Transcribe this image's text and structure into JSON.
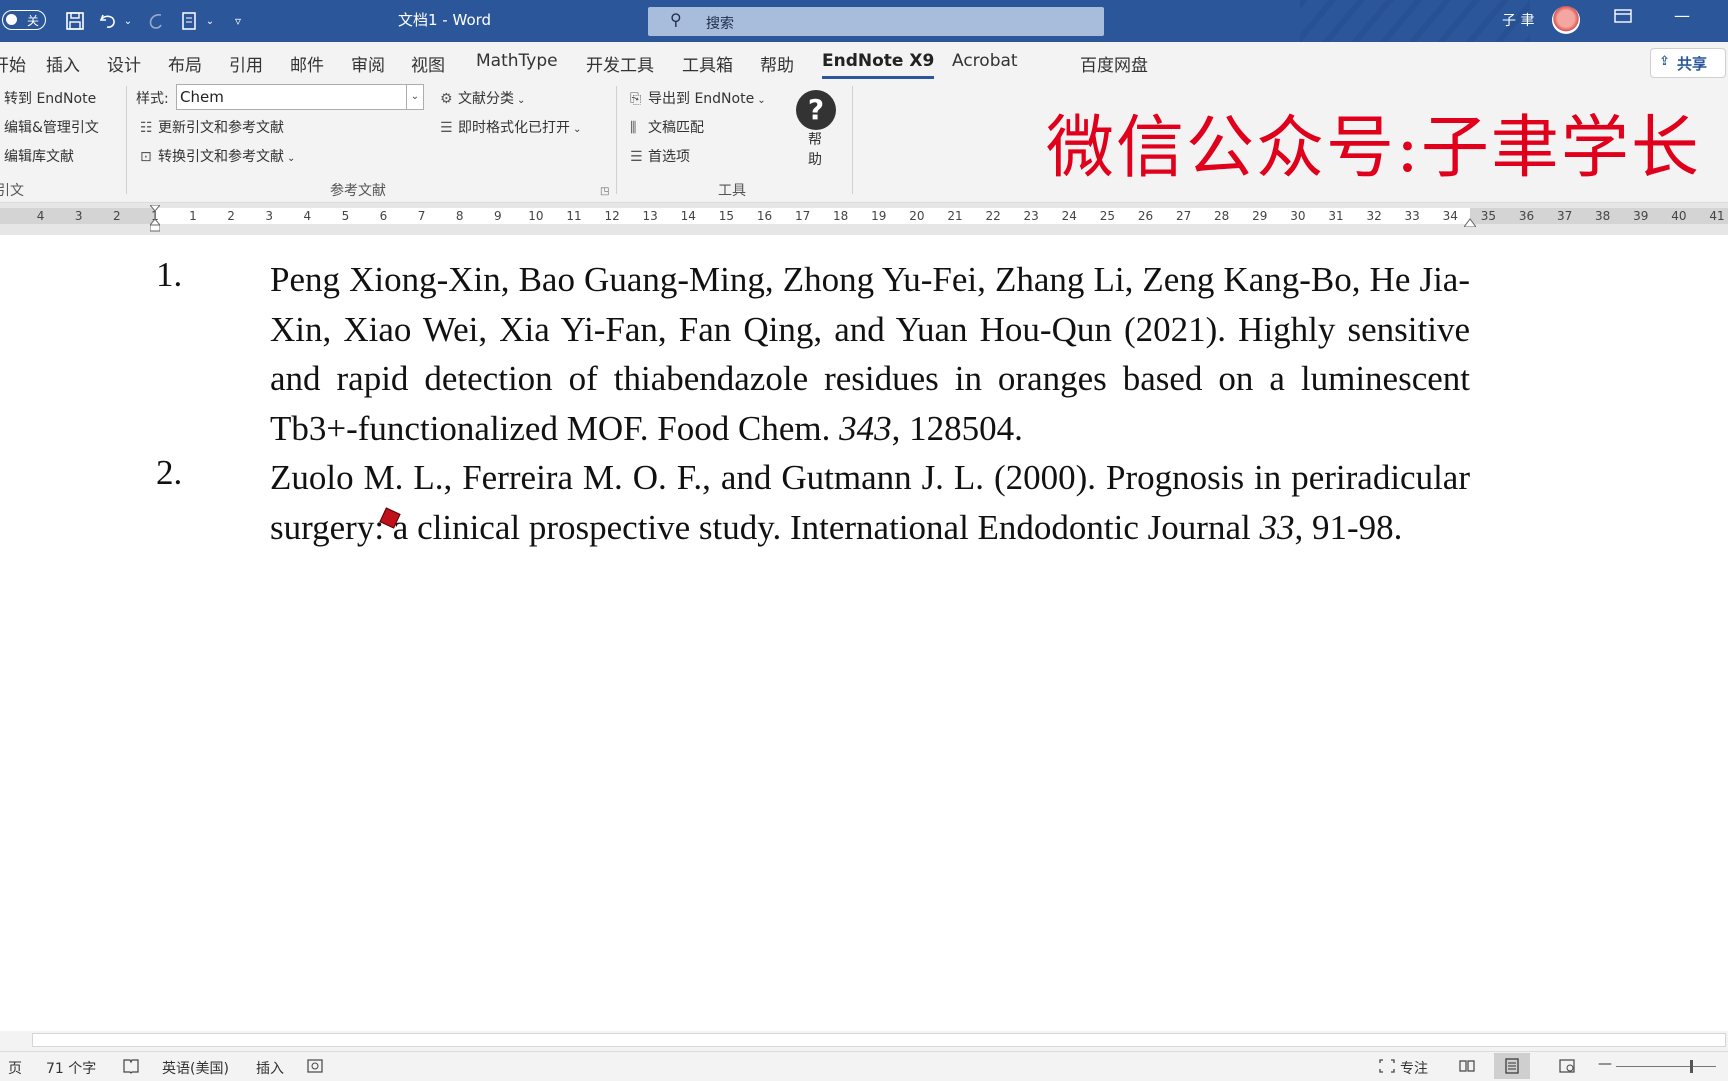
{
  "titlebar": {
    "autosave_state": "关",
    "doc_title": "文档1 - Word",
    "search_placeholder": "搜索",
    "user_name": "子 聿",
    "theme_color": "#2b579a"
  },
  "tabs": [
    "开始",
    "插入",
    "设计",
    "布局",
    "引用",
    "邮件",
    "审阅",
    "视图",
    "MathType",
    "开发工具",
    "工具箱",
    "帮助",
    "EndNote X9",
    "Acrobat",
    "百度网盘"
  ],
  "active_tab": "EndNote X9",
  "share_label": "共享",
  "ribbon": {
    "citations": {
      "go_to_endnote": "转到 EndNote",
      "edit_manage": "编辑&管理引文",
      "edit_library": "编辑库文献",
      "group_label": "引文"
    },
    "bibliography": {
      "style_label": "样式:",
      "style_value": "Chem",
      "update": "更新引文和参考文献",
      "convert": "转换引文和参考文献",
      "categorize": "文献分类",
      "instant_format": "即时格式化已打开",
      "group_label": "参考文献"
    },
    "tools": {
      "export": "导出到 EndNote",
      "manuscript": "文稿匹配",
      "preferences": "首选项",
      "help": "帮助",
      "group_label": "工具"
    },
    "watermark": "微信公众号:子聿学长"
  },
  "ruler": {
    "left_numbers": [
      "4",
      "3",
      "2",
      "1"
    ],
    "right_numbers": [
      "1",
      "2",
      "3",
      "4",
      "5",
      "6",
      "7",
      "8",
      "9",
      "10",
      "11",
      "12",
      "13",
      "14",
      "15",
      "16",
      "17",
      "18",
      "19",
      "20",
      "21",
      "22",
      "23",
      "24",
      "25",
      "26",
      "27",
      "28",
      "29",
      "30",
      "31",
      "32",
      "33",
      "34",
      "35",
      "36",
      "37",
      "38",
      "39",
      "40",
      "41"
    ]
  },
  "references": [
    {
      "number": "1.",
      "text_before_volume": "Peng Xiong-Xin, Bao Guang-Ming, Zhong Yu-Fei, Zhang Li, Zeng Kang-Bo, He Jia-Xin, Xiao Wei, Xia Yi-Fan, Fan Qing, and Yuan Hou-Qun (2021). Highly sensitive and rapid detection of thiabendazole residues in oranges based on a luminescent Tb3+-functionalized MOF. Food Chem. ",
      "volume": "343",
      "pages": ", 128504."
    },
    {
      "number": "2.",
      "text_before_volume": "Zuolo M. L., Ferreira M. O. F., and Gutmann J. L. (2000). Prognosis in periradicular surgery: a clinical prospective study. International Endodontic Journal ",
      "volume": "33",
      "pages": ", 91-98."
    }
  ],
  "statusbar": {
    "page": "页",
    "word_count": "71 个字",
    "language": "英语(美国)",
    "mode": "插入",
    "focus": "专注"
  }
}
